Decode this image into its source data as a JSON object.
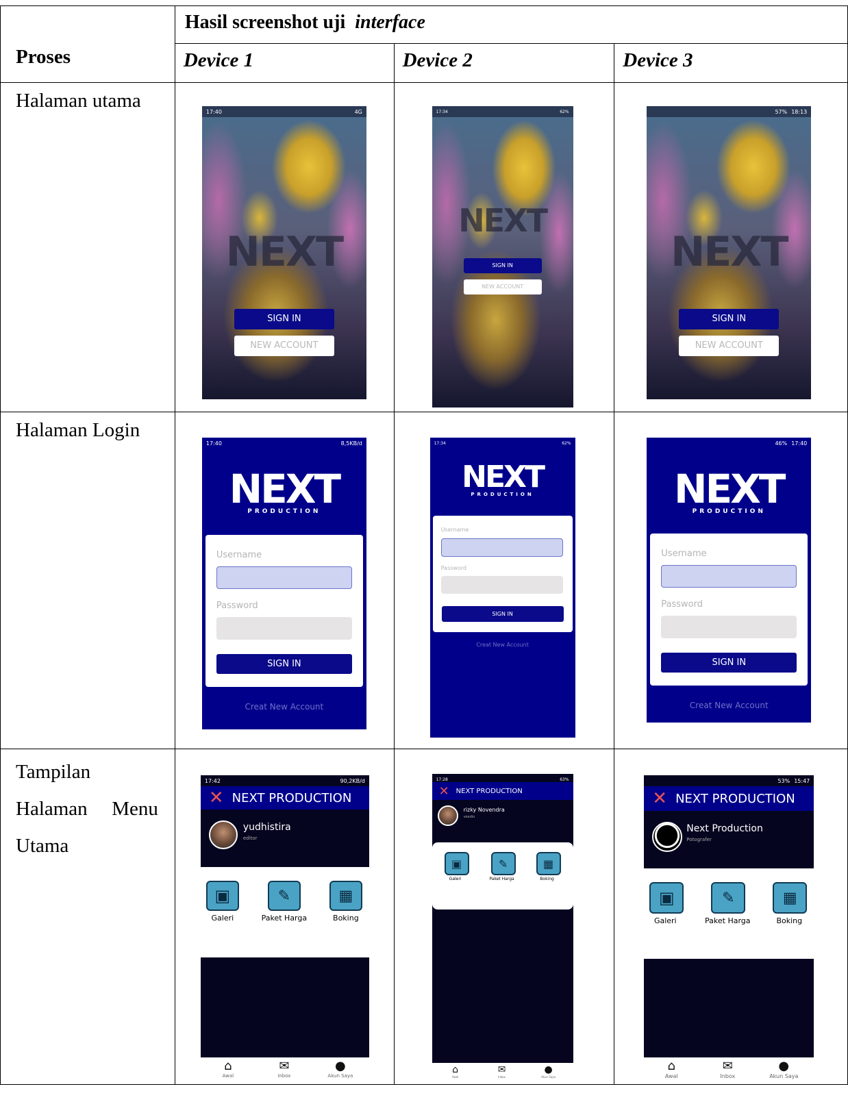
{
  "header": {
    "title_bold": "Hasil screenshot uji",
    "title_italic": "interface",
    "col_label": "Proses",
    "devices": [
      "Device 1",
      "Device 2",
      "Device 3"
    ]
  },
  "rows": [
    {
      "label": "Halaman utama"
    },
    {
      "label": "Halaman Login"
    },
    {
      "label_lines": [
        "Tampilan",
        "Halaman Menu",
        "Utama"
      ]
    }
  ],
  "statusbars": {
    "d1": [
      "17:40",
      "4G",
      "8,5KB/d",
      "17:42",
      "90,2KB/d"
    ],
    "d2": [
      "17:34",
      "62%",
      "17:28",
      "63%"
    ],
    "d3": [
      "57%",
      "18:13",
      "46%",
      "17:40",
      "53%",
      "15:47"
    ]
  },
  "splash": {
    "sign_in": "SIGN IN",
    "new_account": "NEW ACCOUNT"
  },
  "login": {
    "brand": "NEXT",
    "brand_sub": "PRODUCTION",
    "username": "Username",
    "password": "Password",
    "sign_in": "SIGN IN",
    "creat": "Creat New Account"
  },
  "menu": {
    "app_title": "NEXT PRODUCTION",
    "profiles": [
      {
        "name": "yudhistira",
        "role": "editor"
      },
      {
        "name": "rizky Novendra",
        "role": "veedio"
      },
      {
        "name": "Next Production",
        "role": "Potografer"
      }
    ],
    "items": [
      "Galeri",
      "Paket Harga",
      "Boking"
    ],
    "nav": [
      "Awal",
      "Inbox",
      "Akun Saya"
    ]
  }
}
